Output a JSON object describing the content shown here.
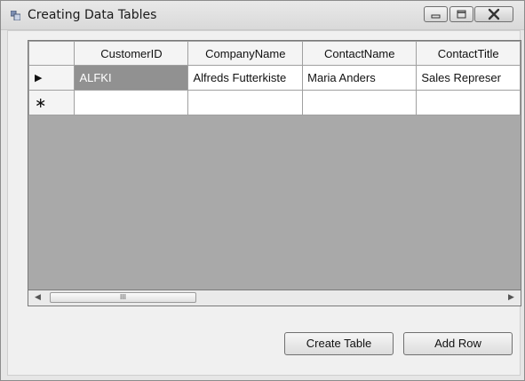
{
  "window": {
    "title": "Creating Data Tables",
    "title_icon": "form-app-icon",
    "controls": [
      "minimize-icon",
      "maximize-icon",
      "close-icon"
    ]
  },
  "grid": {
    "columns": [
      "CustomerID",
      "CompanyName",
      "ContactName",
      "ContactTitle"
    ],
    "rows": [
      {
        "indicator": "▶",
        "cells": [
          "ALFKI",
          "Alfreds Futterkiste",
          "Maria Anders",
          "Sales Represer"
        ]
      },
      {
        "indicator": "∗",
        "cells": [
          "",
          "",
          "",
          ""
        ]
      }
    ],
    "scrollbar": {
      "left_arrow": "◀",
      "right_arrow": "▶",
      "thumb_grip": "III"
    }
  },
  "buttons": {
    "create_table": "Create Table",
    "add_row": "Add Row"
  },
  "colors": {
    "selected_cell": "#919191",
    "grid_background": "#a9a9a9"
  }
}
